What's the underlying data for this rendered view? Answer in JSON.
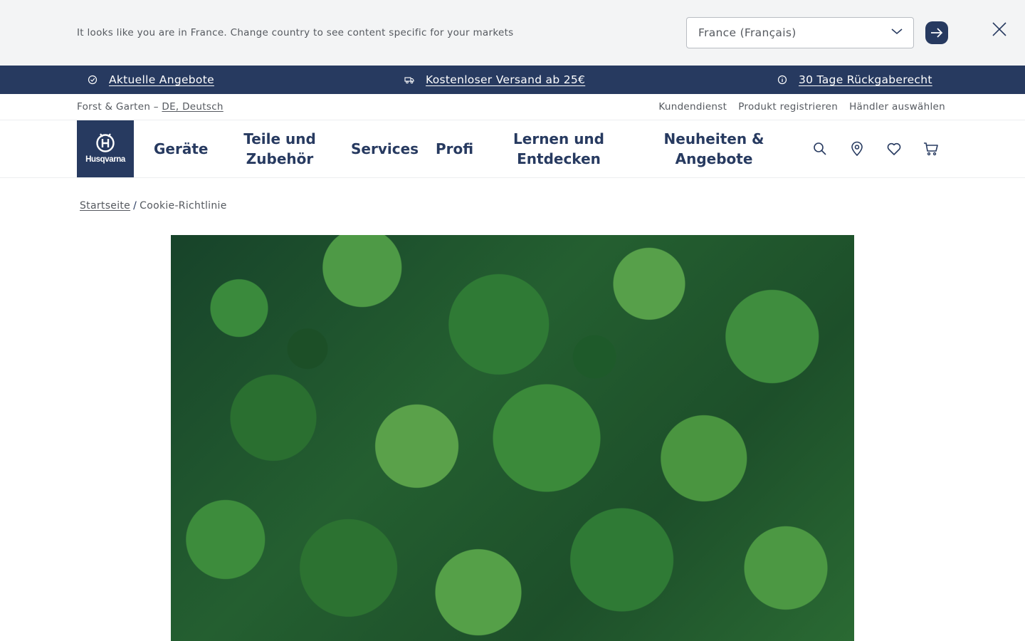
{
  "country_banner": {
    "message": "It looks like you are in France. Change country to see content specific for your markets",
    "selected_country": "France (Français)"
  },
  "usp_bar": {
    "items": [
      {
        "label": "Aktuelle Angebote",
        "icon": "check-circle-icon"
      },
      {
        "label": "Kostenloser Versand ab 25€",
        "icon": "truck-icon"
      },
      {
        "label": "30 Tage Rückgaberecht",
        "icon": "info-icon"
      }
    ]
  },
  "utility": {
    "segment": "Forst & Garten – ",
    "locale": "DE, Deutsch",
    "links": [
      "Kundendienst",
      "Produkt registrieren",
      "Händler auswählen"
    ]
  },
  "header": {
    "logo_text": "Husqvarna",
    "nav": [
      {
        "line1": "Geräte",
        "line2": ""
      },
      {
        "line1": "Teile und",
        "line2": "Zubehör"
      },
      {
        "line1": "Services",
        "line2": ""
      },
      {
        "line1": "Profi",
        "line2": ""
      },
      {
        "line1": "Lernen und",
        "line2": "Entdecken"
      },
      {
        "line1": "Neuheiten &",
        "line2": "Angebote"
      }
    ],
    "icons": [
      "search-icon",
      "location-pin-icon",
      "heart-icon",
      "cart-icon"
    ]
  },
  "breadcrumb": {
    "home": "Startseite",
    "separator": "/",
    "current": "Cookie-Richtlinie"
  },
  "colors": {
    "brand_navy": "#273a60",
    "banner_bg": "#f3f4f5",
    "muted_text": "#55595f"
  }
}
